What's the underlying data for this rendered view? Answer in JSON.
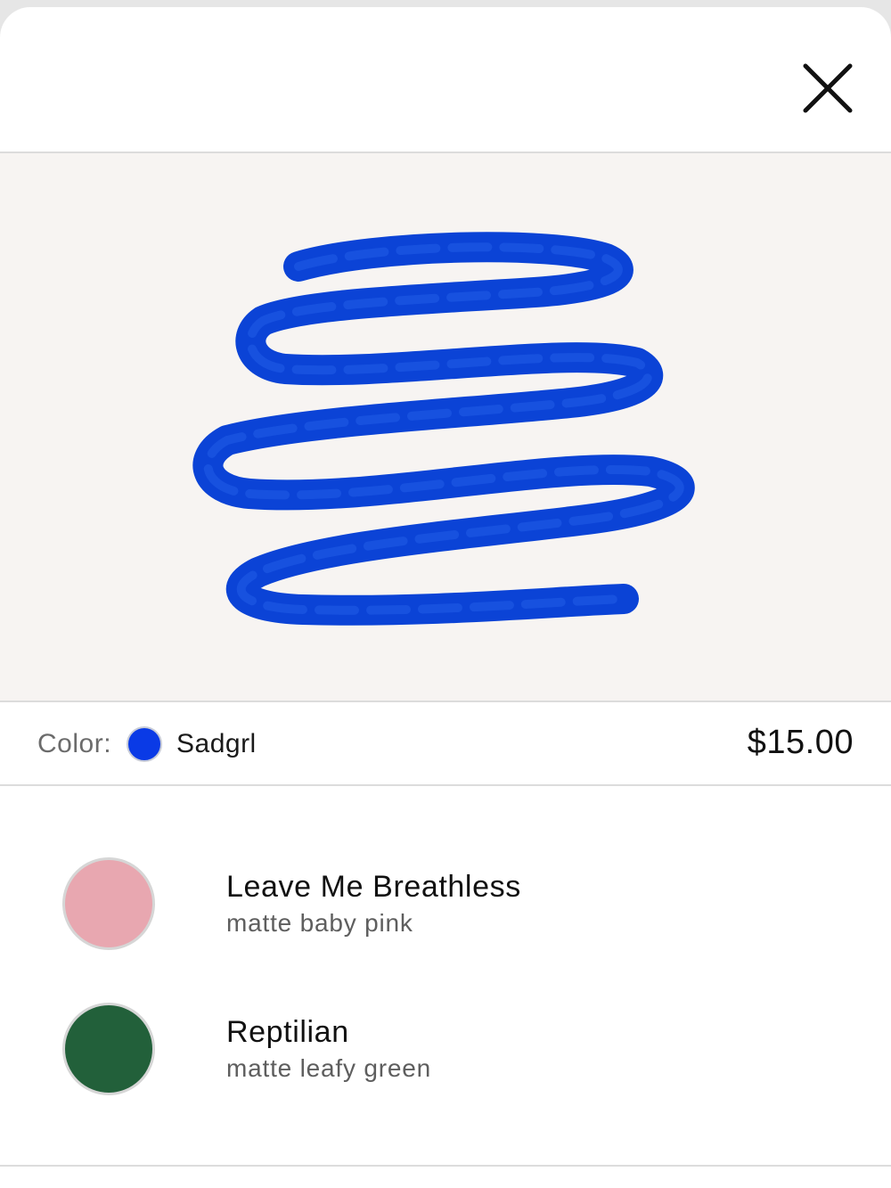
{
  "modal": {
    "close_icon": "close-icon"
  },
  "product": {
    "image_alt": "lip liner swatch scribble",
    "color_label": "Color:",
    "selected_color_name": "Sadgrl",
    "selected_color_hex": "#0a3ae6",
    "price": "$15.00",
    "swatch_stroke_color": "#0b43d6"
  },
  "shades": [
    {
      "name": "Leave Me Breathless",
      "description": "matte baby pink",
      "color": "#e8a7b0"
    },
    {
      "name": "Reptilian",
      "description": "matte leafy green",
      "color": "#22603a"
    }
  ]
}
